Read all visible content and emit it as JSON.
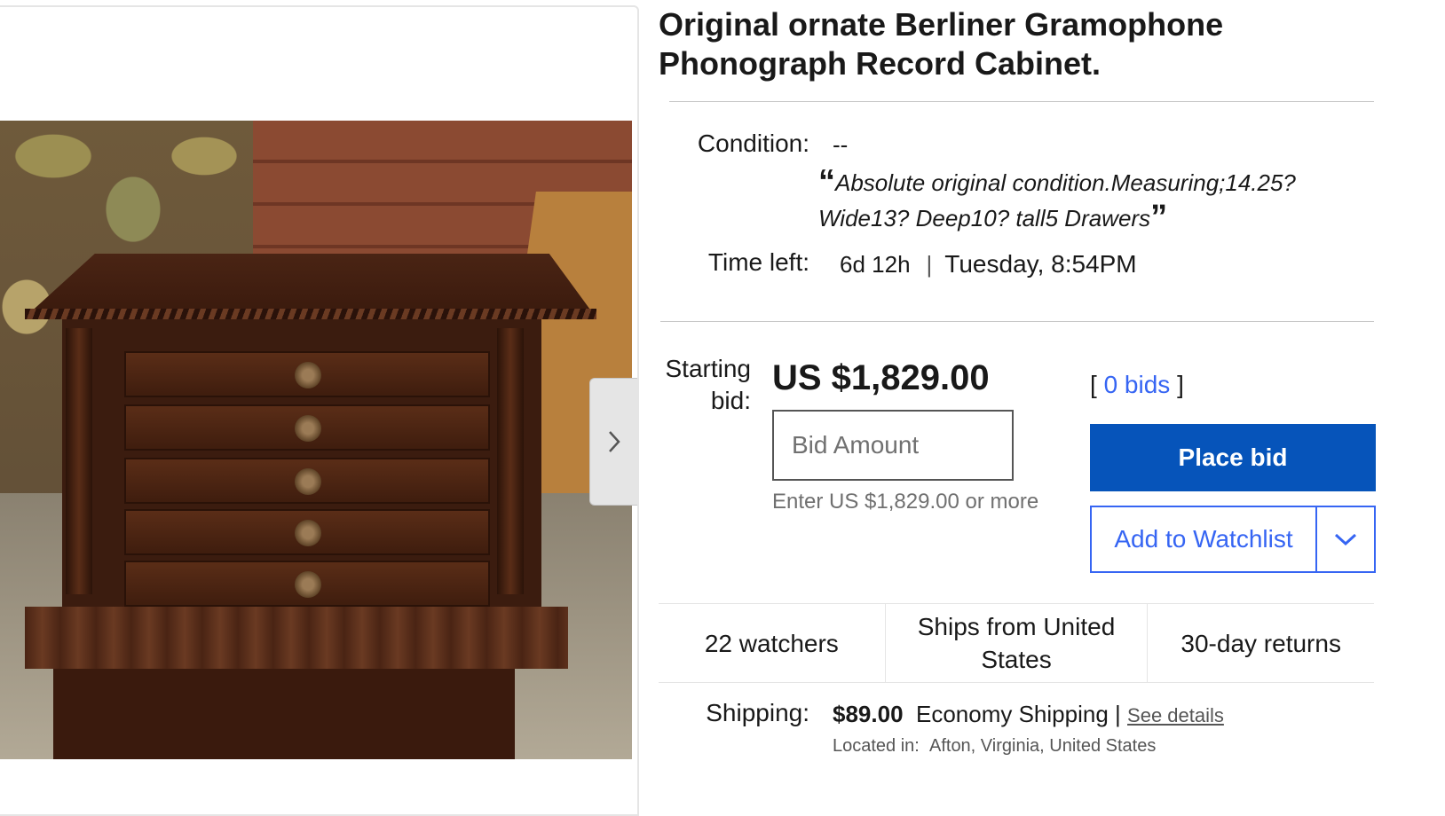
{
  "gallery": {
    "image_alt": "Original ornate Berliner Gramophone Phonograph Record Cabinet with five drawers",
    "next_icon": "chevron-right-icon"
  },
  "item": {
    "title": "Original ornate Berliner Gramophone Phonograph Record Cabinet."
  },
  "condition": {
    "label": "Condition:",
    "value": "--",
    "quote_open": "“",
    "quote": "Absolute original condition.Measuring;14.25? Wide13? Deep10? tall5 Drawers",
    "quote_close": "”"
  },
  "time_left": {
    "label": "Time left:",
    "remaining": "6d 12h",
    "separator": "|",
    "ends": "Tuesday, 8:54PM"
  },
  "bidding": {
    "label_line1": "Starting",
    "label_line2": "bid:",
    "price": "US $1,829.00",
    "input_placeholder": "Bid Amount",
    "hint": "Enter US $1,829.00 or more",
    "bids_open": "[",
    "bids_link": "0 bids",
    "bids_close": "]",
    "place_bid_label": "Place bid",
    "watchlist_label": "Add to Watchlist",
    "watchlist_dropdown_icon": "chevron-down-icon"
  },
  "stats": [
    {
      "label": "22 watchers"
    },
    {
      "label": "Ships from United States"
    },
    {
      "label": "30-day returns"
    }
  ],
  "shipping": {
    "label": "Shipping:",
    "price": "$89.00",
    "method": "Economy Shipping",
    "separator": "|",
    "details_link": "See details",
    "location_label": "Located in:",
    "location": "Afton, Virginia, United States"
  },
  "colors": {
    "primary_button": "#0654ba",
    "link_blue": "#3665f3",
    "text": "#191919",
    "muted": "#707070"
  }
}
